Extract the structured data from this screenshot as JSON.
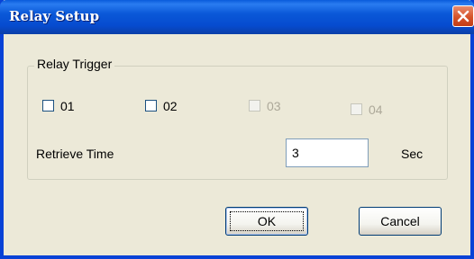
{
  "window": {
    "title": "Relay Setup",
    "close_icon": "close-icon",
    "colors": {
      "titlebar": "#0a58d8",
      "close": "#d6532a",
      "face": "#ece9d8"
    }
  },
  "relay_trigger": {
    "group_label": "Relay Trigger",
    "checkboxes": [
      {
        "label": "01",
        "checked": false,
        "enabled": true
      },
      {
        "label": "02",
        "checked": false,
        "enabled": true
      },
      {
        "label": "03",
        "checked": false,
        "enabled": false
      },
      {
        "label": "04",
        "checked": false,
        "enabled": false
      }
    ],
    "retrieve_time": {
      "label": "Retrieve Time",
      "value": "3",
      "unit": "Sec"
    }
  },
  "buttons": {
    "ok": "OK",
    "cancel": "Cancel"
  }
}
